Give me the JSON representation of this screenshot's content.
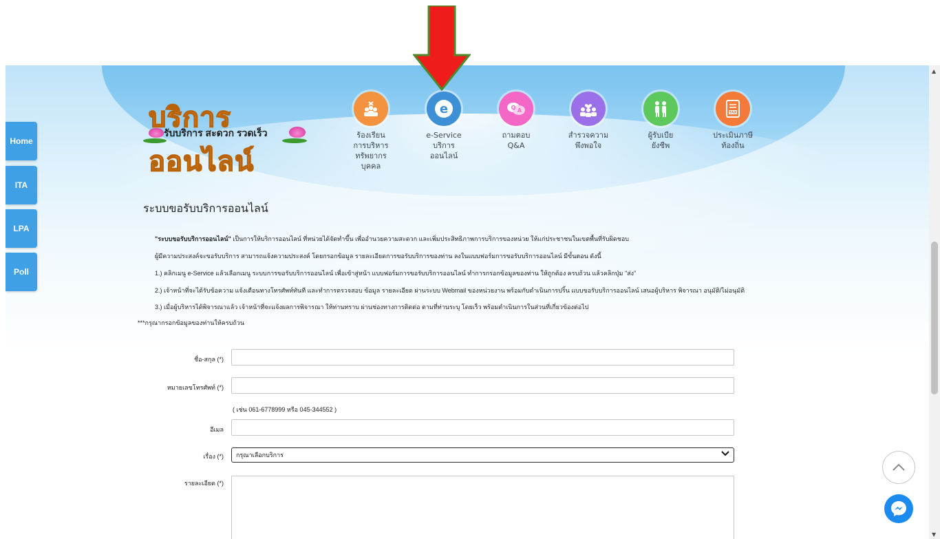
{
  "side_nav": [
    "Home",
    "ITA",
    "LPA",
    "Poll"
  ],
  "logo": {
    "title": "บริการออนไลน์",
    "subtitle": "รับบริการ สะดวก รวดเร็ว"
  },
  "top_nav": [
    {
      "label": "ร้องเรียน\nการบริหาร\nทรัพยากร\nบุคคล",
      "icon": "people-x-icon",
      "color": "#f4933f"
    },
    {
      "label": "e-Service\nบริการ\nออนไลน์",
      "icon": "e-letter-icon",
      "color": "#3d8fd6"
    },
    {
      "label": "ถามตอบ\nQ&A",
      "icon": "qa-bubbles-icon",
      "color": "#f467c7"
    },
    {
      "label": "สำรวจความ\nพึงพอใจ",
      "icon": "satisfaction-people-icon",
      "color": "#9b6fe8"
    },
    {
      "label": "ผู้รับเบีย\nยังชีพ",
      "icon": "elderly-people-icon",
      "color": "#5dc95d"
    },
    {
      "label": "ประเมินภาษี\nท้องถิ่น",
      "icon": "tax-document-icon",
      "color": "#f47a3a"
    }
  ],
  "page_title": "ระบบขอรับบริการออนไลน์",
  "intro": {
    "bold_prefix": "\"ระบบขอรับบริการออนไลน์\"",
    "line1_rest": " เป็นการให้บริการออนไลน์ ที่หน่วยได้จัดทำขึ้น เพื่ออำนวยความสะดวก และเพิ่มประสิทธิภาพการบริการของหน่วย ให้แก่ประชาชนในเขตพื้นที่รับผิดชอบ",
    "line2": "ผู้มีความประสงค์จะขอรับบริการ สามารถแจ้งความประสงค์ โดยกรอกข้อมูล รายละเอียดการขอรับบริการของท่าน ลงในแบบฟอร์มการขอรับบริการออนไลน์ มีขั้นตอน ดังนี้",
    "step1": "1.) คลิกเมนู e-Service แล้วเลือกเมนู ระบบการขอรับบริการออนไลน์ เพื่อเข้าสู่หน้า แบบฟอร์มการขอรับบริการออนไลน์ ทำการกรอกข้อมูลของท่าน ให้ถูกต้อง ครบถ้วน แล้วคลิกปุ่ม \"ส่ง\"",
    "step2": "2.) เจ้าหน้าที่จะได้รับข้อความ แจ้งเตือนทางโทรศัพท์ทันที และทำการตรวจสอบ ข้อมูล รายละเอียด ผ่านระบบ Webmail ของหน่วยงาน พร้อมกับดำเนินการปริ้น แบบขอรับบริการออนไลน์ เสนอผู้บริหาร พิจารณา อนุมัติ/ไม่อนุมัติ",
    "step3": "3.) เมื่อผู้บริหารได้พิจารณาแล้ว เจ้าหน้าที่จะแจ้งผลการพิจารณา ให้ท่านทราบ ผ่านช่องทางการติดต่อ ตามที่ท่านระบุ โดยเร็ว พร้อมดำเนินการในส่วนที่เกี่ยวข้องต่อไป",
    "note": "***กรุณากรอกข้อมูลของท่านให้ครบถ้วน"
  },
  "form": {
    "name_label": "ชื่อ-สกุล (*)",
    "phone_label": "หมายเลขโทรศัพท์ (*)",
    "phone_hint": "( เช่น 061-6778999 หรือ 045-344552 )",
    "email_label": "อีเมล",
    "subject_label": "เรื่อง (*)",
    "subject_selected": "กรุณาเลือกบริการ",
    "detail_label": "รายละเอียด (*)"
  }
}
